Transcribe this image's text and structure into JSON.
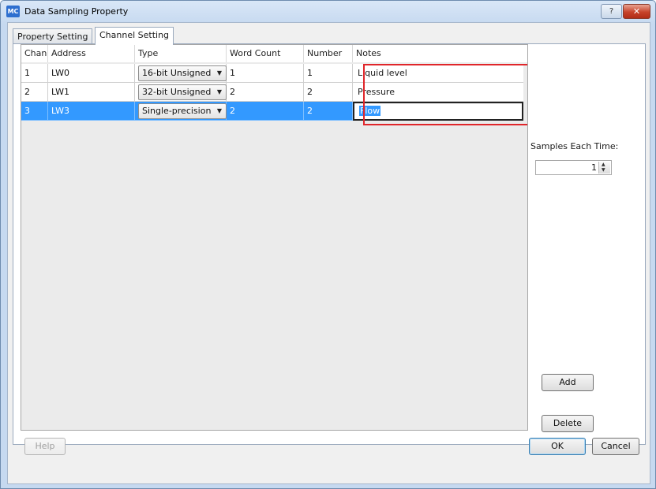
{
  "window": {
    "app_icon_text": "MC",
    "title": "Data Sampling Property",
    "help_glyph": "?",
    "close_glyph": "✕"
  },
  "tabs": [
    {
      "label": "Property Setting",
      "active": false
    },
    {
      "label": "Channel Setting",
      "active": true
    }
  ],
  "table": {
    "columns": [
      "Chan",
      "Address",
      "Type",
      "Word Count",
      "Number",
      "Notes"
    ],
    "rows": [
      {
        "chan": "1",
        "address": "LW0",
        "type": "16-bit Unsigned",
        "word_count": "1",
        "number": "1",
        "notes": "Liquid level",
        "selected": false
      },
      {
        "chan": "2",
        "address": "LW1",
        "type": "32-bit Unsigned",
        "word_count": "2",
        "number": "2",
        "notes": "Pressure",
        "selected": false
      },
      {
        "chan": "3",
        "address": "LW3",
        "type": "Single-precision",
        "word_count": "2",
        "number": "2",
        "notes": "Flow",
        "selected": true
      }
    ],
    "dropdown_glyph": "▼"
  },
  "samples": {
    "label": "Samples Each Time:",
    "value": "1",
    "up_glyph": "▲",
    "down_glyph": "▼"
  },
  "buttons": {
    "add": "Add",
    "delete": "Delete",
    "help": "Help",
    "ok": "OK",
    "cancel": "Cancel"
  },
  "colors": {
    "selection": "#3399ff",
    "highlight_box": "#e0262a"
  }
}
